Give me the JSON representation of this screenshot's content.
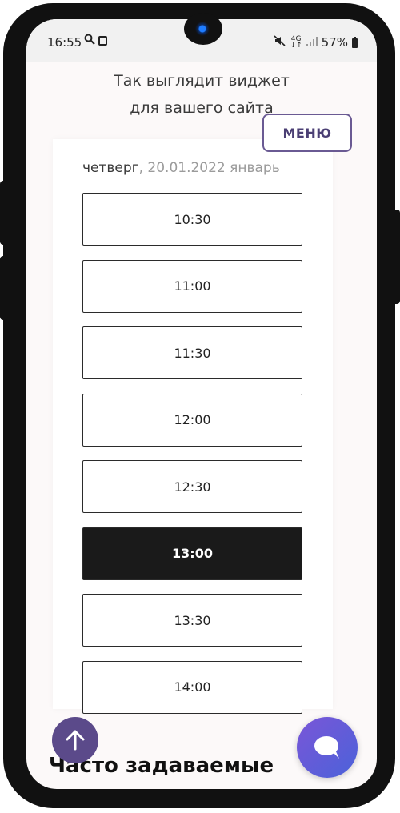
{
  "status_bar": {
    "time": "16:55",
    "network_top": "4G",
    "network_bottom": "↓↑",
    "battery": "57%"
  },
  "intro": {
    "line1": "Так выглядит виджет",
    "line2": "для вашего сайта"
  },
  "menu": {
    "label": "МЕНЮ"
  },
  "widget": {
    "day": "четверг",
    "rest": ", 20.01.2022 январь",
    "slots": [
      {
        "time": "10:30"
      },
      {
        "time": "11:00"
      },
      {
        "time": "11:30"
      },
      {
        "time": "12:00"
      },
      {
        "time": "12:30"
      },
      {
        "time": "13:00"
      },
      {
        "time": "13:30"
      },
      {
        "time": "14:00"
      }
    ]
  },
  "faq": {
    "title": "Часто задаваемые"
  },
  "colors": {
    "accent": "#5b4a8a",
    "selected_slot": "#1a1a1a",
    "chat_gradient_start": "#7a56d8",
    "chat_gradient_end": "#4b62d9"
  }
}
